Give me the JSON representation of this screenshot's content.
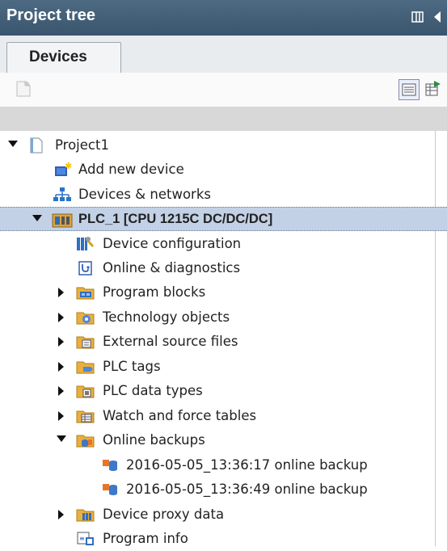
{
  "panel": {
    "title": "Project tree"
  },
  "tabs": [
    {
      "label": "Devices"
    }
  ],
  "tree": {
    "project": "Project1",
    "add_new_device": "Add new device",
    "devices_networks": "Devices & networks",
    "plc": "PLC_1 [CPU 1215C DC/DC/DC]",
    "device_configuration": "Device configuration",
    "online_diagnostics": "Online & diagnostics",
    "program_blocks": "Program blocks",
    "technology_objects": "Technology objects",
    "external_source_files": "External source files",
    "plc_tags": "PLC tags",
    "plc_data_types": "PLC data types",
    "watch_force_tables": "Watch and force tables",
    "online_backups": "Online backups",
    "backup_1": "2016-05-05_13:36:17 online backup",
    "backup_2": "2016-05-05_13:36:49 online backup",
    "device_proxy_data": "Device proxy data",
    "program_info": "Program info"
  },
  "colors": {
    "title_bar": "#455f77",
    "selected_row": "#c3d1e6",
    "folder": "#e9b03d"
  }
}
